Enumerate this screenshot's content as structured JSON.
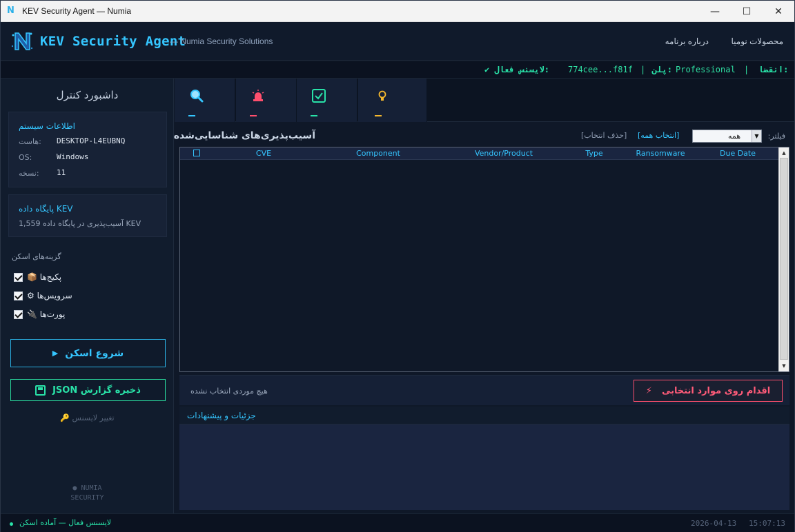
{
  "window": {
    "title": "KEV Security Agent — Numia",
    "minimize": "—",
    "maximize": "☐",
    "close": "✕"
  },
  "header": {
    "app_title": "KEV Security Agent",
    "subtitle": "— Numia Security Solutions",
    "menu_about": "درباره برنامه",
    "menu_products": "محصولات نومیا"
  },
  "license_bar": {
    "status": "✔ لایسنس فعال:",
    "key": "774cee...f81f",
    "sep1": "|",
    "plan_label": "پلن:",
    "plan_value": "Professional",
    "sep2": "|",
    "expiry_label": "انقضا:"
  },
  "sidebar": {
    "title": "داشبورد کنترل",
    "system_info": {
      "title": "اطلاعات سیستم",
      "host_label": "هاست:",
      "host_value": "DESKTOP-L4EUBNQ",
      "os_label": "OS:",
      "os_value": "Windows",
      "version_label": "نسخه:",
      "version_value": "11"
    },
    "kev_db": {
      "title": "پایگاه داده KEV",
      "summary": "1,559 آسیب‌پذیری در پایگاه داده KEV"
    },
    "scan_options_title": "گزینه‌های اسکن",
    "scan_options": [
      {
        "label": "📦 پکیج‌ها",
        "checked": true
      },
      {
        "label": "⚙ سرویس‌ها",
        "checked": true
      },
      {
        "label": "🔌 پورت‌ها",
        "checked": true
      }
    ],
    "scan_button": "شروع اسکن",
    "save_button": "ذخیره گزارش JSON",
    "change_license": "تغییر لایسنس 🔑",
    "brand_line1": "● NUMIA",
    "brand_line2": "SECURITY"
  },
  "tabs": [
    {
      "icon": "search-icon",
      "color": "#35c6ff"
    },
    {
      "icon": "alarm-icon",
      "color": "#ff4f6d"
    },
    {
      "icon": "check-icon",
      "color": "#29e2a8"
    },
    {
      "icon": "bulb-icon",
      "color": "#f5b82e"
    }
  ],
  "vulns": {
    "title": "آسیب‌پذیری‌های شناسایی‌شده",
    "filter_label": "فیلتر:",
    "filter_value": "همه",
    "select_all": "[انتخاب همه]",
    "deselect_all": "[حذف انتخاب]",
    "columns": [
      "CVE",
      "Component",
      "Vendor/Product",
      "Type",
      "Ransomware",
      "Due Date"
    ],
    "rows": []
  },
  "action": {
    "no_selection": "هیچ موردی انتخاب نشده",
    "button": "اقدام روی موارد انتخابی",
    "bolt": "⚡"
  },
  "details": {
    "title": "جزئیات و پیشنهادات"
  },
  "status": {
    "text": "لایسنس فعال — آماده اسکن",
    "date": "2026-04-13",
    "time": "15:07:13"
  },
  "colors": {
    "accent": "#35c6ff",
    "success": "#29e2a8",
    "danger": "#ff4f6d",
    "warning": "#f5b82e",
    "bg": "#0f1828"
  }
}
